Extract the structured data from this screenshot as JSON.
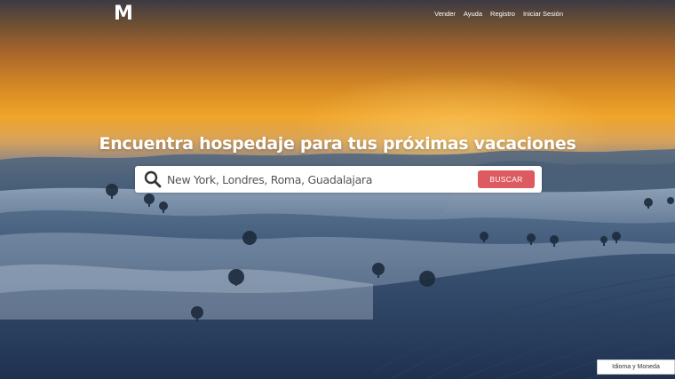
{
  "brand": {
    "logo_letter": "M"
  },
  "nav": {
    "items": [
      {
        "label": "Vender"
      },
      {
        "label": "Ayuda"
      },
      {
        "label": "Registro"
      },
      {
        "label": "Iniciar Sesión"
      }
    ]
  },
  "hero": {
    "headline": "Encuentra hospedaje para tus próximas vacaciones"
  },
  "search": {
    "placeholder": "New York, Londres, Roma, Guadalajara",
    "value": "",
    "button_label": "BUSCAR",
    "icon": "search-icon"
  },
  "footer": {
    "language_currency_label": "Idioma y Moneda"
  },
  "colors": {
    "accent": "#dd5a60",
    "text_on_hero": "#ffffff"
  }
}
